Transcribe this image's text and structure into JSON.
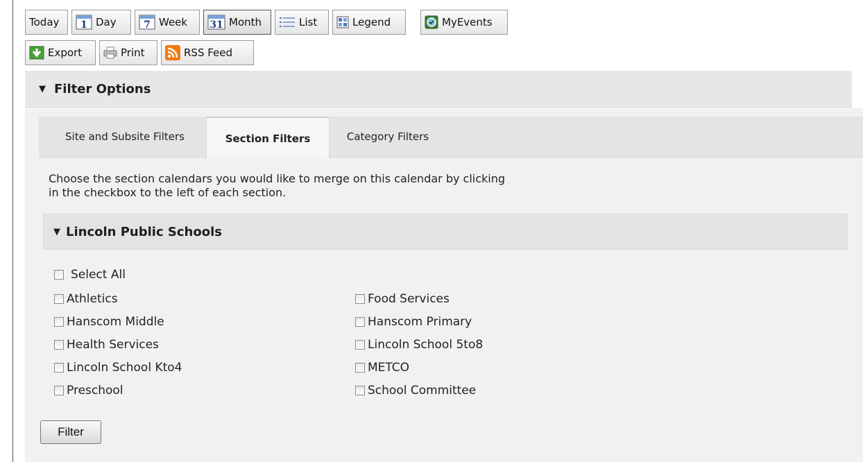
{
  "toolbar": {
    "row1": [
      {
        "label": "Today",
        "icon": ""
      },
      {
        "label": "Day",
        "icon": "calendar-day-icon",
        "glyph": "1"
      },
      {
        "label": "Week",
        "icon": "calendar-week-icon",
        "glyph": "7"
      },
      {
        "label": "Month",
        "icon": "calendar-month-icon",
        "glyph": "31"
      },
      {
        "label": "List",
        "icon": "list-icon"
      },
      {
        "label": "Legend",
        "icon": "legend-grid-icon"
      },
      {
        "label": "MyEvents",
        "icon": "myevents-icon"
      }
    ],
    "row2": [
      {
        "label": "Export",
        "icon": "export-arrow-icon"
      },
      {
        "label": "Print",
        "icon": "printer-icon"
      },
      {
        "label": "RSS Feed",
        "icon": "rss-icon"
      }
    ]
  },
  "filter_options": {
    "title": "Filter Options"
  },
  "tabs": [
    {
      "label": "Site and Subsite Filters",
      "active": false
    },
    {
      "label": "Section Filters",
      "active": true
    },
    {
      "label": "Category Filters",
      "active": false
    }
  ],
  "description": {
    "line1": "Choose the section calendars you would like to merge on this calendar by clicking",
    "line2": "in the checkbox to the left of each section."
  },
  "section_group": {
    "title": "Lincoln Public Schools"
  },
  "select_all_label": "Select All",
  "sections_left": [
    "Athletics",
    "Hanscom Middle",
    "Health Services",
    "Lincoln School Kto4",
    "Preschool"
  ],
  "sections_right": [
    "Food Services",
    "Hanscom Primary",
    "Lincoln School 5to8",
    "METCO",
    "School Committee"
  ],
  "filter_button": {
    "label": "Filter"
  },
  "colors": {
    "panel_bg": "#f1f1f1",
    "header_bg": "#e7e7e7",
    "rss_orange": "#f07a10",
    "export_green": "#3a9a2c"
  }
}
